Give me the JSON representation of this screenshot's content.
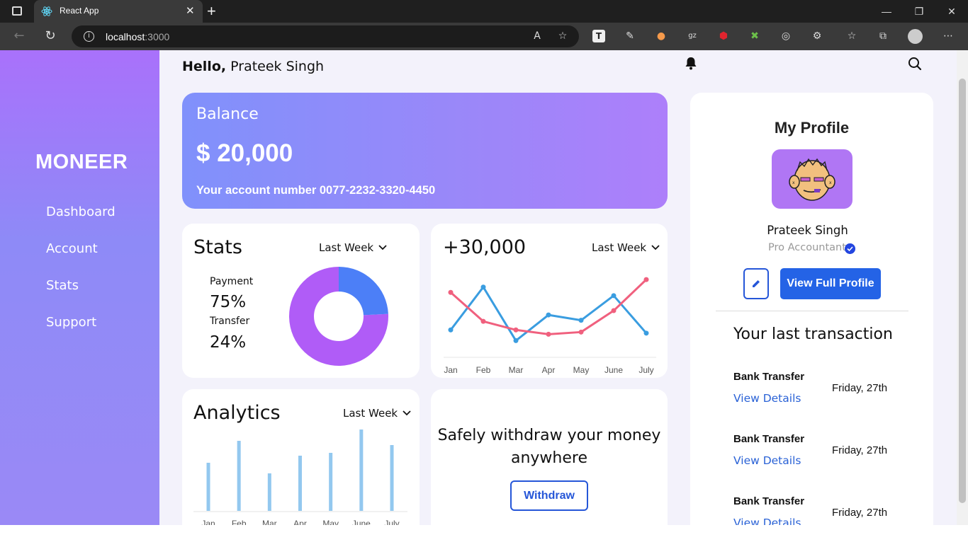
{
  "browser": {
    "tab_title": "React App",
    "url_host": "localhost",
    "url_port": ":3000"
  },
  "sidebar": {
    "logo": "MONEER",
    "items": [
      {
        "label": "Dashboard"
      },
      {
        "label": "Account"
      },
      {
        "label": "Stats"
      },
      {
        "label": "Support"
      }
    ]
  },
  "header": {
    "greeting": "Hello,",
    "user_name": "Prateek Singh"
  },
  "balance": {
    "title": "Balance",
    "amount": "$ 20,000",
    "account_label": "Your account number 0077-2232-3320-4450"
  },
  "stats": {
    "title": "Stats",
    "period": "Last Week",
    "payment_label": "Payment",
    "payment_value": "75%",
    "transfer_label": "Transfer",
    "transfer_value": "24%"
  },
  "trend": {
    "title": "+30,000",
    "period": "Last Week"
  },
  "analytics": {
    "title": "Analytics",
    "period": "Last Week"
  },
  "withdraw": {
    "text": "Safely withdraw your money anywhere",
    "button": "Withdraw"
  },
  "profile": {
    "title": "My Profile",
    "name": "Prateek Singh",
    "role": "Pro Accountant",
    "view_button": "View Full Profile",
    "transactions_title": "Your last transaction",
    "transactions": [
      {
        "name": "Bank Transfer",
        "link": "View Details",
        "date": "Friday, 27th"
      },
      {
        "name": "Bank Transfer",
        "link": "View Details",
        "date": "Friday, 27th"
      },
      {
        "name": "Bank Transfer",
        "link": "View Details",
        "date": "Friday, 27th"
      }
    ]
  },
  "colors": {
    "accent_blue": "#2463e6",
    "donut_purple": "#b05cf7",
    "donut_blue": "#4c7ff7",
    "line_blue": "#3a9de0",
    "line_pink": "#f0607e",
    "bar_blue": "#93c8ef"
  },
  "chart_data": [
    {
      "type": "pie",
      "categories": [
        "Payment",
        "Transfer"
      ],
      "values": [
        75,
        24
      ]
    },
    {
      "type": "line",
      "categories": [
        "Jan",
        "Feb",
        "Mar",
        "Apr",
        "May",
        "June",
        "July"
      ],
      "series": [
        {
          "values": [
            15,
            55,
            5,
            29,
            24,
            47,
            12
          ]
        },
        {
          "values": [
            50,
            23,
            15,
            11,
            13,
            33,
            62
          ]
        }
      ],
      "ylim": [
        0,
        70
      ],
      "grid": false
    },
    {
      "type": "bar",
      "categories": [
        "Jan",
        "Feb",
        "Mar",
        "Apr",
        "May",
        "June",
        "July"
      ],
      "values": [
        68,
        99,
        53,
        78,
        82,
        115,
        93
      ],
      "ylim": [
        0,
        125
      ],
      "grid": false
    }
  ]
}
